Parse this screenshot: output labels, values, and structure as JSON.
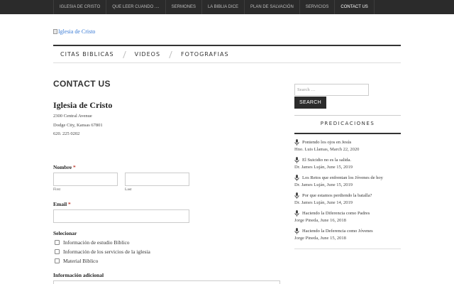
{
  "top_nav": [
    {
      "label": "IGLESIA DE CRISTO",
      "active": false
    },
    {
      "label": "QUE LEER CUANDO ....",
      "active": false
    },
    {
      "label": "SERMONES",
      "active": false
    },
    {
      "label": "LA BIBLIA DICE",
      "active": false
    },
    {
      "label": "PLAN DE SALVACIÓN",
      "active": false
    },
    {
      "label": "SERVICIOS",
      "active": false
    },
    {
      "label": "CONTACT US",
      "active": true
    }
  ],
  "logo": {
    "alt_text": "Iglesia de Cristo",
    "icon": "broken-image-icon"
  },
  "secondary_nav": [
    "CITAS BIBLICAS",
    "VIDEOS",
    "FOTOGRAFIAS"
  ],
  "page": {
    "title": "CONTACT US"
  },
  "contact": {
    "org_name": "Iglesia de Cristo",
    "address_line1": "2300 Central Avenue",
    "address_line2": "Dodge City, Kansas 67801",
    "phone": "620. 225 0202"
  },
  "form": {
    "name_label": "Nombre",
    "required_mark": "*",
    "first_label": "First",
    "last_label": "Last",
    "email_label": "Email",
    "select_label": "Selecionar",
    "options": [
      "Información de estudio Bíblico",
      "Información de los servicios de la iglesia",
      "Material Bíblico"
    ],
    "additional_label": "Información adicional"
  },
  "sidebar": {
    "search_placeholder": "Search …",
    "search_button": "SEARCH",
    "widget_title": "PREDICACIONES",
    "posts": [
      {
        "title": "Poniendo los ojos en Jesús",
        "meta": "Hno. Luis Llamas, March 22, 2020"
      },
      {
        "title": "El Suicidio no es la salida.",
        "meta": "Dr. James Luján, June 15, 2019"
      },
      {
        "title": "Los Retos que enfrentan los Jóvenes de hoy",
        "meta": "Dr. James Luján, June 15, 2019"
      },
      {
        "title": "Por que estamos perdiendo la batalla?",
        "meta": "Dr. James Luján, June 14, 2019"
      },
      {
        "title": "Haciendo la Diferencia como Padres",
        "meta": "Jorge Pineda, June 16, 2018"
      },
      {
        "title": "Haciendo la Deferencia como Jóvenes",
        "meta": "Jorge Pineda, June 15, 2018"
      }
    ]
  },
  "colors": {
    "topbar": "#2b2b2b",
    "accent_required": "#c0392b",
    "link": "#3a7bd5"
  }
}
